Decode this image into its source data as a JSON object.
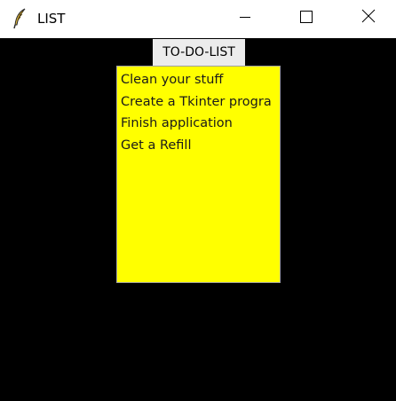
{
  "window": {
    "title": "LIST",
    "app_icon": "feather-icon",
    "controls": {
      "minimize": "minimize-icon",
      "maximize": "maximize-icon",
      "close": "close-icon"
    }
  },
  "label": {
    "text": "TO-DO-LIST"
  },
  "listbox": {
    "background": "#ffff00",
    "items": [
      "Clean your stuff",
      "Create a Tkinter progra",
      "Finish application",
      "Get a Refill"
    ]
  }
}
